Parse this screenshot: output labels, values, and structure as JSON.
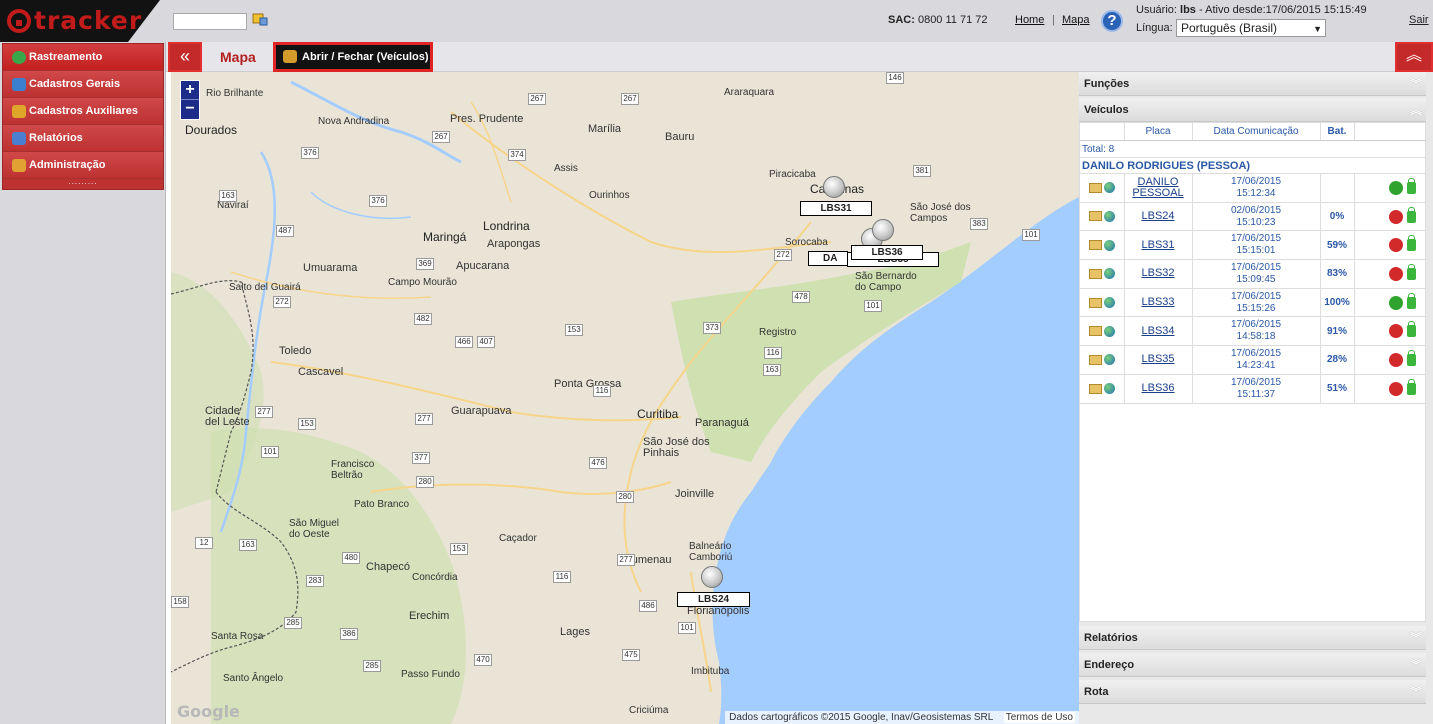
{
  "app": {
    "logo_text": "tracker"
  },
  "header": {
    "sac_label": "SAC:",
    "sac_number": "0800 11 71 72",
    "home_link": "Home",
    "separator": "|",
    "mapa_link": "Mapa",
    "user_label": "Usuário:",
    "user_name": "lbs",
    "user_since": "- Ativo desde:17/06/2015 15:15:49",
    "lingua_label": "Língua:",
    "lingua_value": "Português (Brasil)",
    "logout": "Sair",
    "search_value": ""
  },
  "sidebar": {
    "items": [
      {
        "label": "Rastreamento",
        "icon": "globe-icon",
        "color": "#3aa64a"
      },
      {
        "label": "Cadastros Gerais",
        "icon": "edit-icon",
        "color": "#3b7fd1"
      },
      {
        "label": "Cadastros Auxiliares",
        "icon": "tools-icon",
        "color": "#e0a62a"
      },
      {
        "label": "Relatórios",
        "icon": "report-icon",
        "color": "#4a7fd0"
      },
      {
        "label": "Administração",
        "icon": "admin-icon",
        "color": "#e2a233"
      }
    ],
    "dots": "........."
  },
  "toolbar": {
    "collapse_left": "«",
    "tab_label": "Mapa",
    "toggle_label": "Abrir / Fechar (Veículos)",
    "collapse_right": "︽"
  },
  "map": {
    "zoom_in": "+",
    "zoom_out": "−",
    "attribution": "Dados cartográficos ©2015 Google, Inav/Geosistemas SRL",
    "terms": "Termos de Uso",
    "google": "Google",
    "cities": [
      "Rio Brilhante",
      "Dourados",
      "Nova Andradina",
      "Naviraí",
      "Maringá",
      "Arapongas",
      "Londrina",
      "Apucarana",
      "Umuarama",
      "Salto del Guairá",
      "Campo Mourão",
      "Toledo",
      "Cascavel",
      "Cidade del Leste",
      "Guarapuava",
      "Ponta Grossa",
      "Curitiba",
      "Paranaguá",
      "São José dos Pinhais",
      "Francisco Beltrão",
      "Pato Branco",
      "São Miguel do Oeste",
      "Chapecó",
      "Concórdia",
      "Caçador",
      "Blumenau",
      "Balneário Camboriú",
      "Joinville",
      "Erechim",
      "Lages",
      "Santa Rosa",
      "Passo Fundo",
      "Santo Ângelo",
      "Imbituba",
      "Criciúma",
      "Pres. Prudente",
      "Marília",
      "Assis",
      "Ourinhos",
      "Bauru",
      "Araraquara",
      "Piracicaba",
      "Campinas",
      "Sorocaba",
      "São José dos Campos",
      "São Bernardo do Campo",
      "Registro",
      "Florianópolis"
    ],
    "roads": [
      "267",
      "267",
      "267",
      "146",
      "376",
      "374",
      "163",
      "376",
      "487",
      "381",
      "383",
      "101",
      "369",
      "272",
      "272",
      "153",
      "482",
      "466",
      "407",
      "373",
      "478",
      "116",
      "163",
      "116",
      "277",
      "277",
      "153",
      "476",
      "377",
      "280",
      "101",
      "280",
      "12",
      "163",
      "153",
      "116",
      "480",
      "277",
      "283",
      "158",
      "470",
      "486",
      "475",
      "101",
      "386",
      "285",
      "285",
      "101"
    ]
  },
  "vehicles_on_map": [
    {
      "label": "LBS31"
    },
    {
      "label": "LBS36"
    },
    {
      "label": "LBS35"
    },
    {
      "label": "DA"
    },
    {
      "label": "LBS24"
    }
  ],
  "panel": {
    "funcoes": "Funções",
    "veiculos": "Veículos",
    "columns": [
      "Placa",
      "Data Comunicação",
      "Bat."
    ],
    "total": "Total: 8",
    "group": "DANILO RODRIGUES (PESSOA)",
    "rows": [
      {
        "placa": "DANILO PESSOAL",
        "date": "17/06/2015",
        "time": "15:12:34",
        "bat": "",
        "ignition": "on"
      },
      {
        "placa": "LBS24",
        "date": "02/06/2015",
        "time": "15:10:23",
        "bat": "0%",
        "ignition": "off"
      },
      {
        "placa": "LBS31",
        "date": "17/06/2015",
        "time": "15:15:01",
        "bat": "59%",
        "ignition": "off"
      },
      {
        "placa": "LBS32",
        "date": "17/06/2015",
        "time": "15:09:45",
        "bat": "83%",
        "ignition": "off"
      },
      {
        "placa": "LBS33",
        "date": "17/06/2015",
        "time": "15:15:26",
        "bat": "100%",
        "ignition": "on"
      },
      {
        "placa": "LBS34",
        "date": "17/06/2015",
        "time": "14:58:18",
        "bat": "91%",
        "ignition": "off"
      },
      {
        "placa": "LBS35",
        "date": "17/06/2015",
        "time": "14:23:41",
        "bat": "28%",
        "ignition": "off"
      },
      {
        "placa": "LBS36",
        "date": "17/06/2015",
        "time": "15:11:37",
        "bat": "51%",
        "ignition": "off"
      }
    ],
    "relatorios": "Relatórios",
    "endereco": "Endereço",
    "rota": "Rota"
  }
}
